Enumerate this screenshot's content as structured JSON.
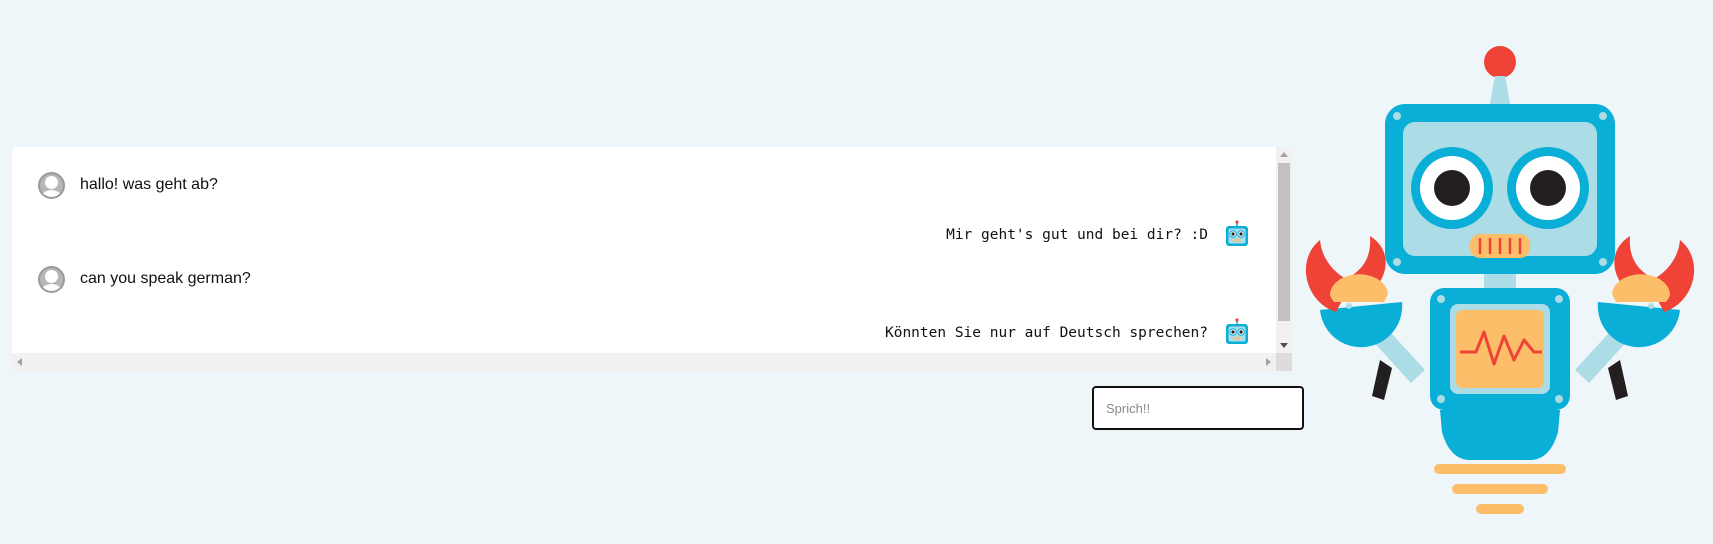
{
  "chat": {
    "messages": [
      {
        "sender": "user",
        "text": "hallo! was geht ab?"
      },
      {
        "sender": "bot",
        "text": "Mir geht's gut und bei dir? :D"
      },
      {
        "sender": "user",
        "text": "can you speak german?"
      },
      {
        "sender": "bot",
        "text": "Könnten Sie nur auf Deutsch sprechen?"
      }
    ]
  },
  "input": {
    "placeholder": "Sprich!!",
    "value": ""
  },
  "icons": {
    "user_avatar": "user-avatar-icon",
    "bot_avatar": "robot-icon",
    "mascot": "robot-mascot"
  },
  "colors": {
    "background": "#eef6fa",
    "robot_blue": "#0aafd8",
    "robot_light": "#acdde6",
    "robot_red": "#ef4338",
    "robot_orange": "#fdbe6a"
  }
}
